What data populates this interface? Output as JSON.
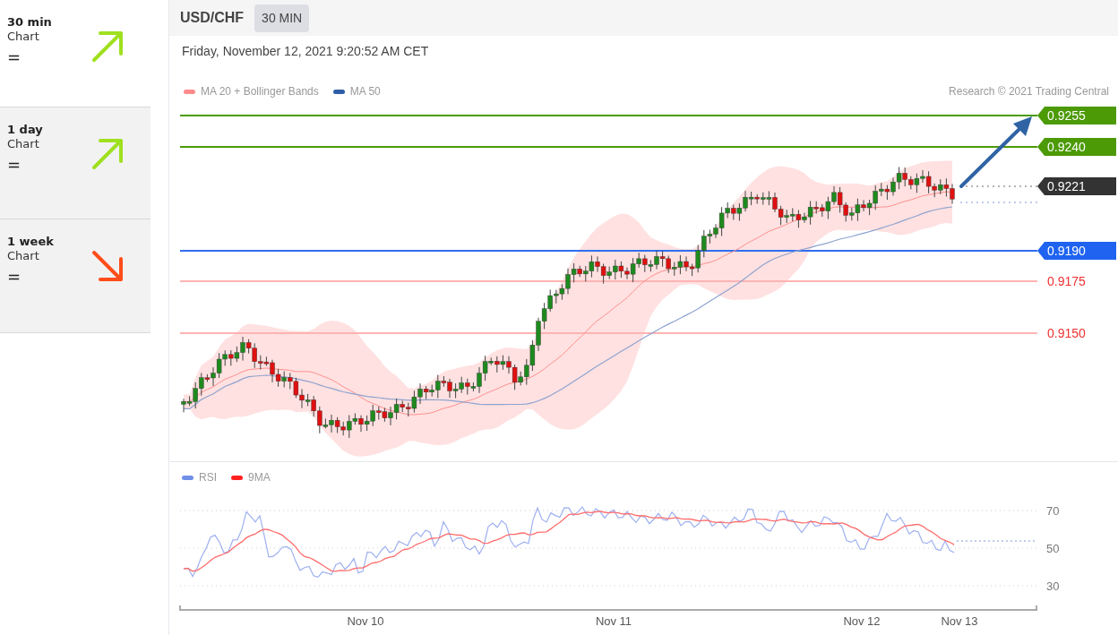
{
  "sidebar": {
    "items": [
      {
        "period": "30 min",
        "label": "Chart",
        "kind": "up",
        "signal": "=",
        "selected": true
      },
      {
        "period": "1 day",
        "label": "Chart",
        "kind": "up",
        "signal": "=",
        "selected": false
      },
      {
        "period": "1 week",
        "label": "Chart",
        "kind": "down",
        "signal": "=",
        "selected": false
      }
    ]
  },
  "header": {
    "pair": "USD/CHF",
    "timeframe": "30 MIN"
  },
  "timestamp": "Friday, November 12, 2021 9:20:52 AM CET",
  "legend": [
    {
      "label": "MA 20 + Bollinger Bands",
      "color": "#ff8a8a"
    },
    {
      "label": "MA 50",
      "color": "#2f5ea8"
    }
  ],
  "copyright": "Research © 2021 Trading Central",
  "levels": [
    {
      "kind": "resistance",
      "value": "0.9255"
    },
    {
      "kind": "resistance",
      "value": "0.9240"
    },
    {
      "kind": "last",
      "value": "0.9221"
    },
    {
      "kind": "pivot",
      "value": "0.9190"
    },
    {
      "kind": "support",
      "value": "0.9175"
    },
    {
      "kind": "support",
      "value": "0.9150"
    }
  ],
  "rsi": {
    "legend": [
      {
        "label": "RSI",
        "color": "#6f8fe8"
      },
      {
        "label": "9MA",
        "color": "#ff2020"
      }
    ],
    "yticks": [
      "70",
      "50",
      "30"
    ],
    "xlabels": [
      "Nov 10",
      "Nov 11",
      "Nov 12",
      "Nov 13"
    ]
  }
}
